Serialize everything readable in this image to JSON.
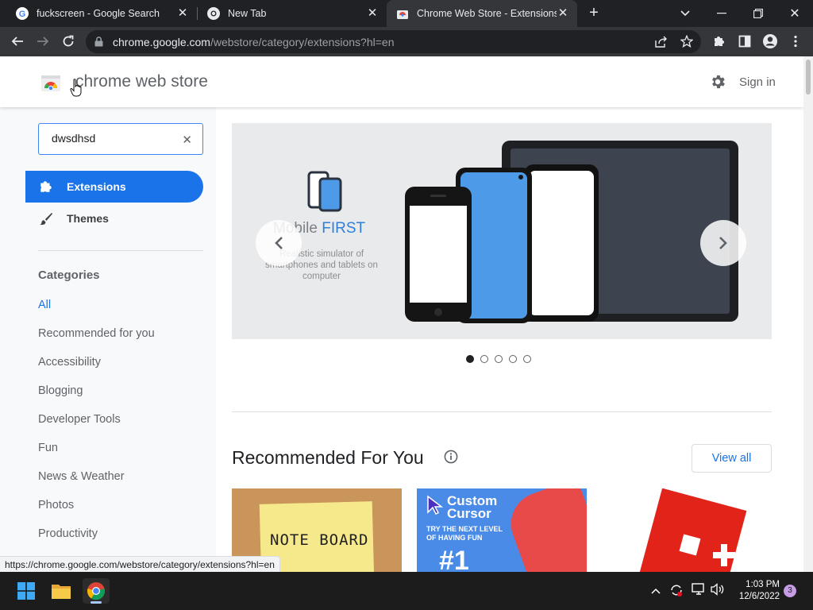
{
  "browser": {
    "tabs": [
      {
        "title": "fuckscreen - Google Search",
        "active": false
      },
      {
        "title": "New Tab",
        "active": false
      },
      {
        "title": "Chrome Web Store - Extensions",
        "active": true
      }
    ],
    "new_tab_label": "+",
    "url_host": "chrome.google.com",
    "url_path": "/webstore/category/extensions?hl=en"
  },
  "header": {
    "title": "chrome web store",
    "signin_label": "Sign in"
  },
  "search": {
    "value": "dwsdhsd"
  },
  "nav": {
    "items": [
      {
        "label": "Extensions",
        "active": true
      },
      {
        "label": "Themes",
        "active": false
      }
    ]
  },
  "categories": {
    "heading": "Categories",
    "items": [
      "All",
      "Recommended for you",
      "Accessibility",
      "Blogging",
      "Developer Tools",
      "Fun",
      "News & Weather",
      "Photos",
      "Productivity"
    ]
  },
  "hero": {
    "title_part1": "Mobile ",
    "title_part2": "FIRST",
    "subtitle": "Realistic simulator of smartphones and tablets on computer",
    "slide_count": 5,
    "active_slide": 1
  },
  "recommended": {
    "title": "Recommended For You",
    "view_all_label": "View all",
    "cards": [
      {
        "label": "NOTE BOARD"
      },
      {
        "label": "Custom Cursor",
        "tagline": "TRY THE NEXT LEVEL OF HAVING FUN",
        "badge": "#1"
      },
      {
        "label": ""
      }
    ]
  },
  "status_url": "https://chrome.google.com/webstore/category/extensions?hl=en",
  "taskbar": {
    "time": "1:03 PM",
    "date": "12/6/2022",
    "notification_count": "3"
  },
  "colors": {
    "accent": "#1a73e8",
    "chrome_dark": "#202124",
    "toolbar": "#35363a"
  }
}
